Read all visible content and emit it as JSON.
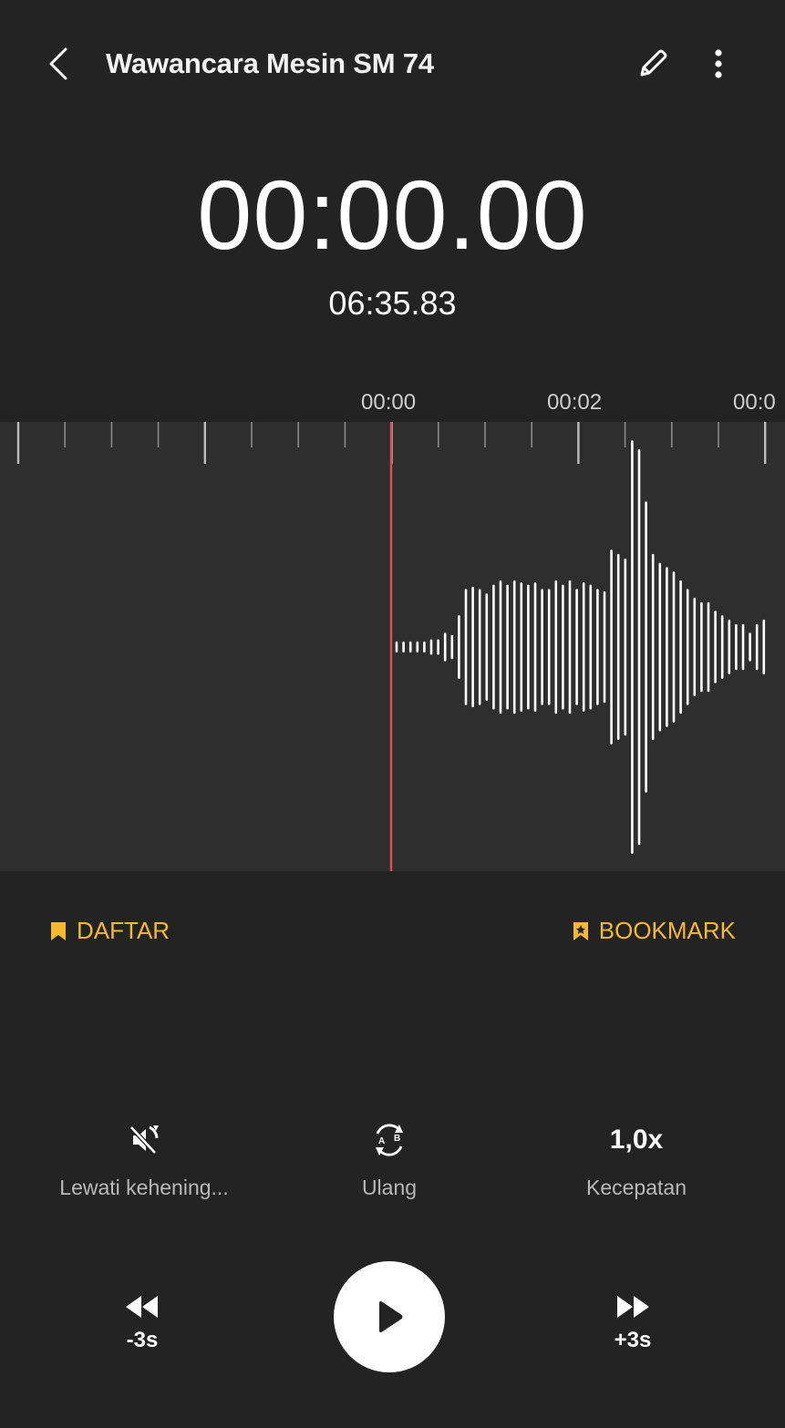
{
  "header": {
    "title": "Wawancara Mesin SM 74",
    "back_icon": "chevron-left-icon",
    "edit_icon": "pencil-icon",
    "more_icon": "more-vertical-icon"
  },
  "playback": {
    "current_time": "00:00.00",
    "total_time": "06:35.83"
  },
  "timeline": {
    "labels": [
      "00:00",
      "00:02",
      "00:0"
    ],
    "playhead_color": "#e0504a"
  },
  "bookmarks": {
    "list_label": "DAFTAR",
    "bookmark_label": "BOOKMARK",
    "accent_color": "#f5b82e"
  },
  "options": {
    "skip_silence_label": "Lewati kehening...",
    "repeat_label": "Ulang",
    "speed_value": "1,0x",
    "speed_label": "Kecepatan"
  },
  "controls": {
    "rewind_label": "-3s",
    "forward_label": "+3s",
    "play_icon": "play-icon"
  },
  "waveform": {
    "amplitudes": [
      0.02,
      0.02,
      0.02,
      0.02,
      0.02,
      0.03,
      0.03,
      0.06,
      0.05,
      0.14,
      0.26,
      0.27,
      0.26,
      0.24,
      0.28,
      0.3,
      0.28,
      0.3,
      0.29,
      0.28,
      0.29,
      0.26,
      0.26,
      0.3,
      0.28,
      0.3,
      0.26,
      0.29,
      0.28,
      0.26,
      0.25,
      0.44,
      0.42,
      0.4,
      0.94,
      0.9,
      0.66,
      0.42,
      0.38,
      0.36,
      0.34,
      0.3,
      0.26,
      0.22,
      0.2,
      0.2,
      0.16,
      0.14,
      0.12,
      0.1,
      0.1,
      0.06,
      0.1,
      0.12
    ]
  }
}
